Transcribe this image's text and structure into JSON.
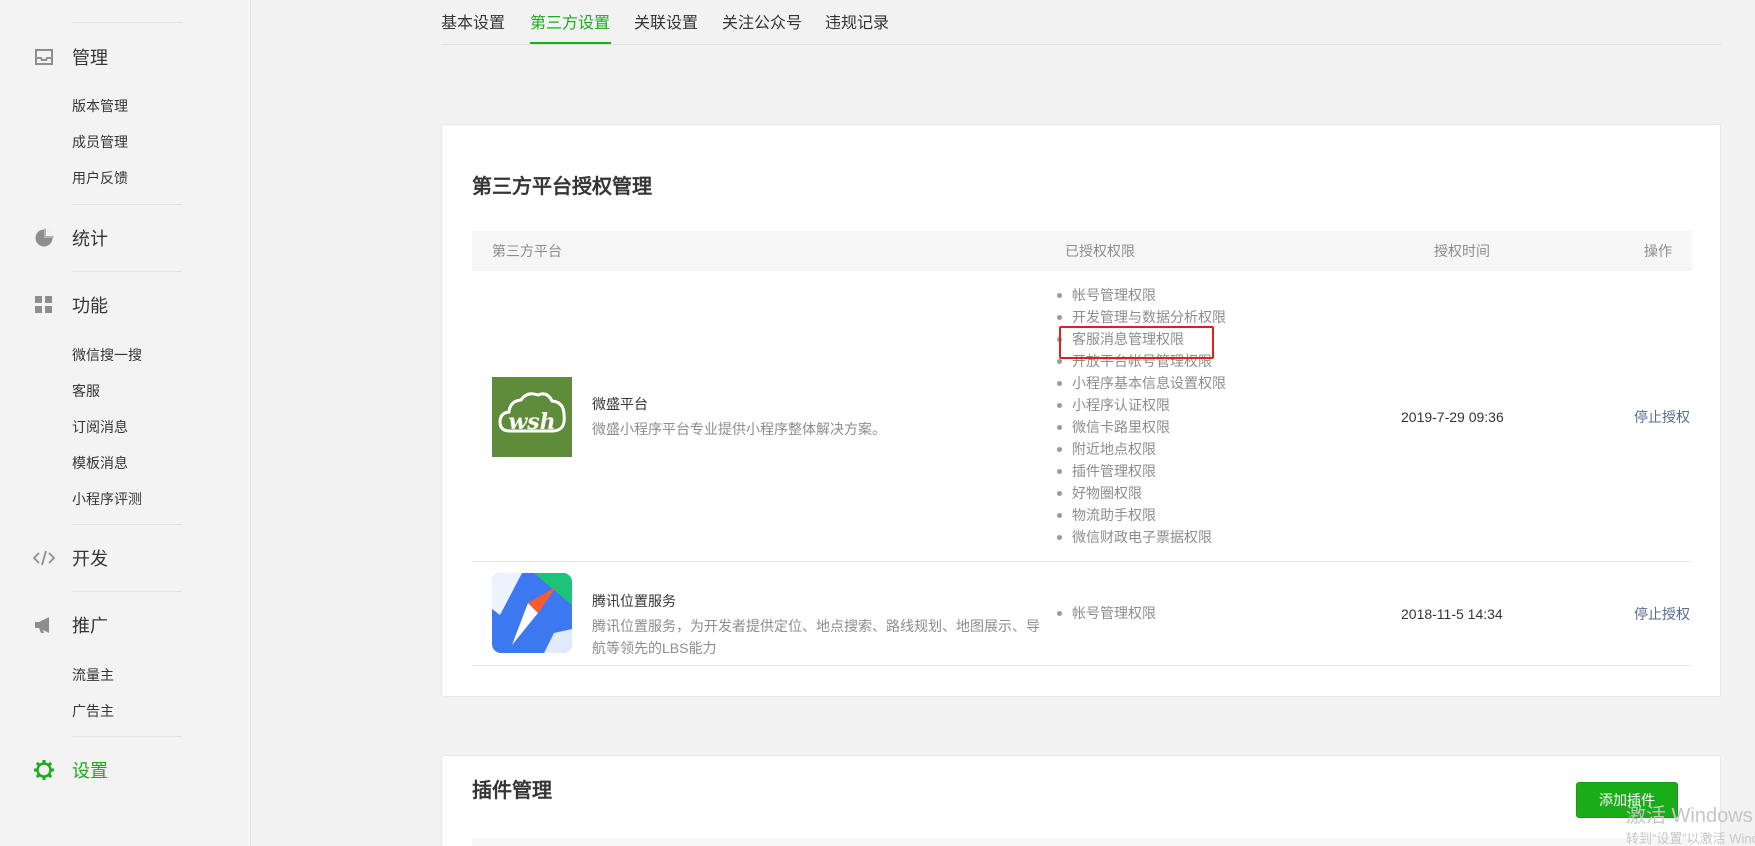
{
  "sidebar": {
    "sections": [
      {
        "label": "管理",
        "icon": "inbox-icon",
        "items": [
          "版本管理",
          "成员管理",
          "用户反馈"
        ]
      },
      {
        "label": "统计",
        "icon": "pie-chart-icon",
        "items": []
      },
      {
        "label": "功能",
        "icon": "grid-icon",
        "items": [
          "微信搜一搜",
          "客服",
          "订阅消息",
          "模板消息",
          "小程序评测"
        ]
      },
      {
        "label": "开发",
        "icon": "code-icon",
        "items": []
      },
      {
        "label": "推广",
        "icon": "megaphone-icon",
        "items": [
          "流量主",
          "广告主"
        ]
      },
      {
        "label": "设置",
        "icon": "gear-icon",
        "items": [],
        "active": true
      }
    ]
  },
  "tabs": [
    {
      "label": "基本设置"
    },
    {
      "label": "第三方设置",
      "active": true
    },
    {
      "label": "关联设置"
    },
    {
      "label": "关注公众号"
    },
    {
      "label": "违规记录"
    }
  ],
  "third_party": {
    "title": "第三方平台授权管理",
    "columns": [
      "第三方平台",
      "已授权权限",
      "授权时间",
      "操作"
    ],
    "rows": [
      {
        "name": "微盛平台",
        "logo_text": "wsh",
        "desc": "微盛小程序平台专业提供小程序整体解决方案。",
        "permissions": [
          "帐号管理权限",
          "开发管理与数据分析权限",
          "客服消息管理权限",
          "开放平台帐号管理权限",
          "小程序基本信息设置权限",
          "小程序认证权限",
          "微信卡路里权限",
          "附近地点权限",
          "插件管理权限",
          "好物圈权限",
          "物流助手权限",
          "微信财政电子票据权限"
        ],
        "time": "2019-7-29 09:36",
        "action": "停止授权"
      },
      {
        "name": "腾讯位置服务",
        "desc": "腾讯位置服务，为开发者提供定位、地点搜索、路线规划、地图展示、导航等领先的LBS能力",
        "permissions": [
          "帐号管理权限"
        ],
        "time": "2018-11-5 14:34",
        "action": "停止授权"
      }
    ]
  },
  "plugins": {
    "title": "插件管理",
    "add_button": "添加插件"
  },
  "watermark": {
    "line1": "激活 Windows",
    "line2": "转到“设置”以激活 Windows。"
  },
  "colors": {
    "accent": "#1aad19",
    "link": "#576b95",
    "highlight": "#e02020",
    "wsh_logo": "#5e8c3a",
    "tencent_logo": "#3c78f0"
  }
}
